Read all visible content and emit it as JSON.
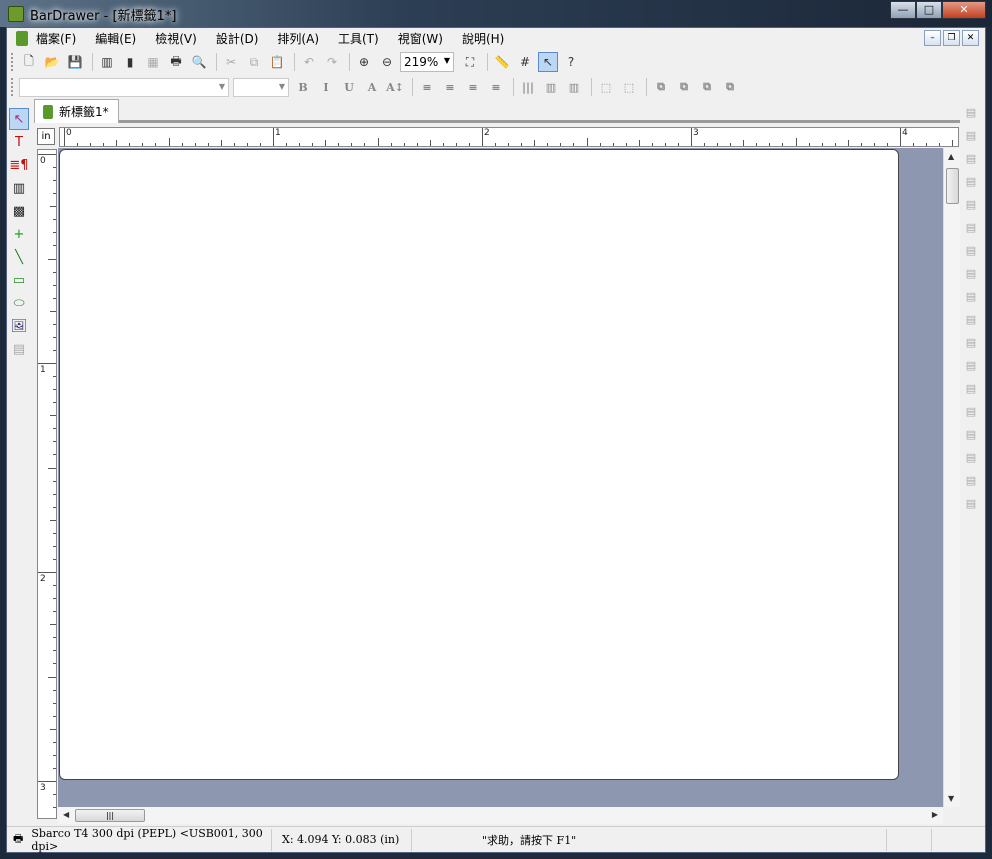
{
  "window": {
    "title": "BarDrawer - [新標籤1*]",
    "minimize": "—",
    "maximize": "□",
    "close": "✕"
  },
  "menu": [
    "檔案(F)",
    "編輯(E)",
    "檢視(V)",
    "設計(D)",
    "排列(A)",
    "工具(T)",
    "視窗(W)",
    "說明(H)"
  ],
  "mdi": {
    "minimize": "–",
    "restore": "❐",
    "close": "✕"
  },
  "toolbar1": [
    {
      "icon": "new-file-icon",
      "g": "🗋"
    },
    {
      "icon": "open-folder-icon",
      "g": "📂"
    },
    {
      "icon": "save-icon",
      "g": "💾"
    },
    "sep",
    {
      "icon": "page-setup-icon",
      "g": "▥"
    },
    {
      "icon": "database-icon",
      "g": "▮"
    },
    {
      "icon": "table-icon",
      "g": "▦",
      "dis": true
    },
    {
      "icon": "print-icon",
      "g": "🖶"
    },
    {
      "icon": "print-preview-icon",
      "g": "🔍"
    },
    "sep",
    {
      "icon": "cut-icon",
      "g": "✂",
      "dis": true
    },
    {
      "icon": "copy-icon",
      "g": "⧉",
      "dis": true
    },
    {
      "icon": "paste-icon",
      "g": "📋"
    },
    "sep",
    {
      "icon": "undo-icon",
      "g": "↶",
      "dis": true
    },
    {
      "icon": "redo-icon",
      "g": "↷",
      "dis": true
    },
    "sep",
    {
      "icon": "zoom-in-icon",
      "g": "⊕"
    },
    {
      "icon": "zoom-out-icon",
      "g": "⊖"
    },
    "zoom",
    {
      "icon": "fit-page-icon",
      "g": "⛶"
    },
    "sep",
    {
      "icon": "ruler-icon",
      "g": "📏"
    },
    {
      "icon": "grid-icon",
      "g": "#"
    },
    {
      "icon": "snap-icon",
      "g": "↖",
      "on": true
    },
    {
      "icon": "help-icon",
      "g": "?"
    }
  ],
  "zoom": {
    "value": "219%"
  },
  "toolbar2": [
    "font",
    "size",
    {
      "icon": "bold-icon",
      "g": "B"
    },
    {
      "icon": "italic-icon",
      "g": "I"
    },
    {
      "icon": "underline-icon",
      "g": "U"
    },
    {
      "icon": "inverse-text-icon",
      "g": "A"
    },
    {
      "icon": "text-spacing-icon",
      "g": "A↕"
    },
    "sep",
    {
      "icon": "align-left-icon",
      "g": "≡"
    },
    {
      "icon": "align-center-icon",
      "g": "≡"
    },
    {
      "icon": "align-right-icon",
      "g": "≡"
    },
    {
      "icon": "justify-icon",
      "g": "≡"
    },
    "sep",
    {
      "icon": "barcode-icon",
      "g": "|||"
    },
    {
      "icon": "barcode-text-below-icon",
      "g": "▥"
    },
    {
      "icon": "barcode-text-above-icon",
      "g": "▥"
    },
    "sep",
    {
      "icon": "group-icon",
      "g": "⬚"
    },
    {
      "icon": "ungroup-icon",
      "g": "⬚"
    },
    "sep",
    {
      "icon": "bring-front-icon",
      "g": "⧉"
    },
    {
      "icon": "send-back-icon",
      "g": "⧉"
    },
    {
      "icon": "forward-icon",
      "g": "⧉"
    },
    {
      "icon": "backward-icon",
      "g": "⧉"
    }
  ],
  "lefttools": [
    {
      "icon": "select-pointer-icon",
      "g": "↖",
      "c": "#a03090",
      "on": true
    },
    {
      "icon": "text-tool-icon",
      "g": "T",
      "c": "#c01010"
    },
    {
      "icon": "paragraph-tool-icon",
      "g": "≣¶",
      "c": "#c01010"
    },
    {
      "icon": "barcode-tool-icon",
      "g": "▥",
      "c": "#222"
    },
    {
      "icon": "2d-barcode-tool-icon",
      "g": "▩",
      "c": "#222"
    },
    {
      "icon": "cross-tool-icon",
      "g": "+",
      "c": "#1a9a1a"
    },
    {
      "icon": "line-tool-icon",
      "g": "╲",
      "c": "#1a7a1a"
    },
    {
      "icon": "rectangle-tool-icon",
      "g": "▭",
      "c": "#2a8a2a"
    },
    {
      "icon": "ellipse-tool-icon",
      "g": "⬭",
      "c": "#2a8a2a"
    },
    {
      "icon": "image-tool-icon",
      "g": "🖼",
      "c": "#336"
    },
    {
      "icon": "rfid-tool-icon",
      "g": "▤",
      "c": "#aaa"
    }
  ],
  "righttools": [
    "align-left-edge-icon",
    "align-right-edge-icon",
    "align-top-icon",
    "align-bottom-icon",
    "center-vertical-icon",
    "center-horizontal-icon",
    "center-page-v-icon",
    "center-page-h-icon",
    "space-horizontal-icon",
    "space-vertical-icon",
    "same-width-icon",
    "same-height-icon",
    "same-size-icon",
    "rotate-icon",
    "flip-icon",
    "rotate-180-icon",
    "lock-icon",
    "unlock-icon"
  ],
  "tab": {
    "label": "新標籤1*"
  },
  "ruler": {
    "unit": "in",
    "h_labels": [
      "0",
      "1",
      "2",
      "3",
      "4"
    ],
    "v_labels": [
      "0",
      "1",
      "2",
      "3"
    ]
  },
  "status": {
    "printer": "Sbarco T4 300 dpi (PEPL) <USB001, 300 dpi>",
    "coords": "X: 4.094  Y: 0.083 (in)",
    "help": "\"求助，請按下 F1\""
  }
}
